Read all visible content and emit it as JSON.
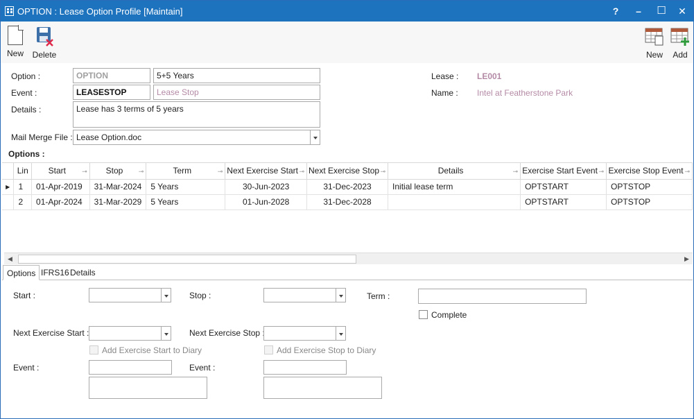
{
  "window": {
    "title": "OPTION : Lease Option Profile [Maintain]",
    "help": "?",
    "minimize": "–",
    "maximize": "☐",
    "close": "✕"
  },
  "toolbar": {
    "new_label": "New",
    "delete_label": "Delete",
    "grid_new_label": "New",
    "grid_add_label": "Add"
  },
  "form": {
    "option_label": "Option :",
    "option_code": "OPTION",
    "option_desc": "5+5 Years",
    "event_label": "Event :",
    "event_code": "LEASESTOP",
    "event_desc": "Lease Stop",
    "details_label": "Details :",
    "details_value": "Lease has 3 terms of 5 years",
    "mailmerge_label": "Mail Merge File :",
    "mailmerge_value": "Lease Option.doc",
    "lease_label": "Lease :",
    "lease_value": "LE001",
    "name_label": "Name :",
    "name_value": "Intel at Featherstone Park",
    "options_heading": "Options :"
  },
  "grid": {
    "columns": [
      "Lin",
      "Start",
      "Stop",
      "Term",
      "Next Exercise Start",
      "Next Exercise Stop",
      "Details",
      "Exercise Start Event",
      "Exercise Stop Event"
    ],
    "rows": [
      {
        "lin": "1",
        "start": "01-Apr-2019",
        "stop": "31-Mar-2024",
        "term": "5 Years",
        "next_start": "30-Jun-2023",
        "next_stop": "31-Dec-2023",
        "details": "Initial lease term",
        "ex_start_event": "OPTSTART",
        "ex_stop_event": "OPTSTOP"
      },
      {
        "lin": "2",
        "start": "01-Apr-2024",
        "stop": "31-Mar-2029",
        "term": "5 Years",
        "next_start": "01-Jun-2028",
        "next_stop": "31-Dec-2028",
        "details": "",
        "ex_start_event": "OPTSTART",
        "ex_stop_event": "OPTSTOP"
      }
    ]
  },
  "tabs": [
    "Options",
    "IFRS16",
    "Details"
  ],
  "detail": {
    "start_label": "Start :",
    "stop_label": "Stop :",
    "term_label": "Term :",
    "complete_label": "Complete",
    "next_start_label": "Next Exercise Start :",
    "next_stop_label": "Next Exercise Stop :",
    "add_start_diary_label": "Add Exercise Start to Diary",
    "add_stop_diary_label": "Add Exercise Stop to Diary",
    "event_label_1": "Event :",
    "event_label_2": "Event :"
  }
}
